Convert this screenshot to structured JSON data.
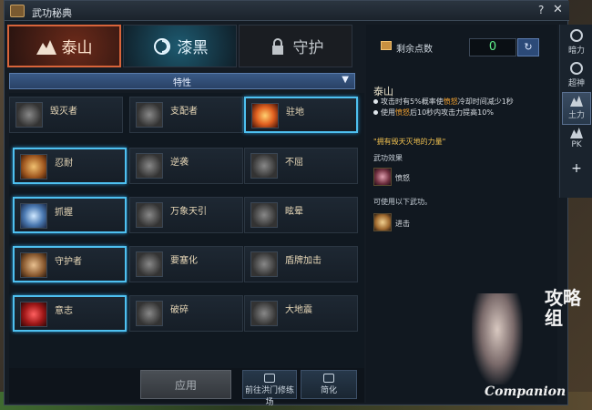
{
  "window": {
    "title": "武功秘典"
  },
  "tabs": [
    {
      "label": "泰山",
      "icon": "mountain-icon",
      "active": true
    },
    {
      "label": "漆黑",
      "icon": "swirl-icon",
      "active": false
    },
    {
      "label": "守护",
      "icon": "lock-icon",
      "active": false
    }
  ],
  "filter": {
    "label": "特性"
  },
  "skills": [
    {
      "label": "毁灭者",
      "selected": false,
      "icon": "gray"
    },
    {
      "label": "支配者",
      "selected": false,
      "icon": "gray"
    },
    {
      "label": "驻地",
      "selected": true,
      "icon": "fire"
    },
    {
      "label": "忍耐",
      "selected": true,
      "icon": "gold"
    },
    {
      "label": "逆袭",
      "selected": false,
      "icon": "gray"
    },
    {
      "label": "不屈",
      "selected": false,
      "icon": "gray"
    },
    {
      "label": "抓握",
      "selected": true,
      "icon": "blue"
    },
    {
      "label": "万象天引",
      "selected": false,
      "icon": "gray"
    },
    {
      "label": "眩晕",
      "selected": false,
      "icon": "gray"
    },
    {
      "label": "守护者",
      "selected": true,
      "icon": "warm"
    },
    {
      "label": "要塞化",
      "selected": false,
      "icon": "gray"
    },
    {
      "label": "盾牌加击",
      "selected": false,
      "icon": "gray"
    },
    {
      "label": "意志",
      "selected": true,
      "icon": "red"
    },
    {
      "label": "破碎",
      "selected": false,
      "icon": "gray"
    },
    {
      "label": "大地震",
      "selected": false,
      "icon": "gray"
    }
  ],
  "buttons": {
    "apply": "应用",
    "training": "前往洪门修练场",
    "simplify": "简化"
  },
  "points": {
    "label": "剩余点数",
    "value": "0"
  },
  "detail": {
    "title": "泰山",
    "line1_pre": "攻击时有5%概率使",
    "line1_hl": "愤怒",
    "line1_post": "冷却时间减少1秒",
    "line2_pre": "使用",
    "line2_hl": "愤怒",
    "line2_post": "后10秒内攻击力提高10%",
    "quote": "\"拥有毁天灭地的力量\"",
    "effect_heading": "武功效果",
    "effect_item": "愤怒",
    "usable_heading": "可使用以下武功。",
    "usable_item": "进击"
  },
  "sidebar": [
    {
      "label": "暗力",
      "icon": "swirl-icon",
      "active": false
    },
    {
      "label": "超神",
      "icon": "swirl-icon",
      "active": false
    },
    {
      "label": "土力",
      "icon": "mountain-icon",
      "active": true
    },
    {
      "label": "PK",
      "icon": "mountain-icon",
      "active": false
    }
  ],
  "sidebar_add": "+",
  "watermark": {
    "text": "Companion",
    "cjk": "攻略组"
  }
}
